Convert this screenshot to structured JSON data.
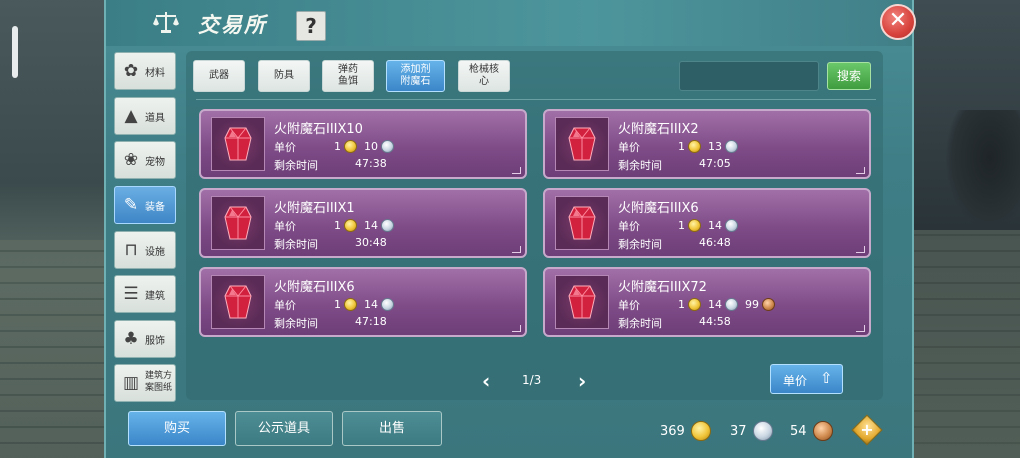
{
  "window": {
    "title": "交易所",
    "help_label": "?",
    "close_label": "✕"
  },
  "sidebar": {
    "items": [
      {
        "label": "材料",
        "icon": "materials-icon",
        "glyph": "✿",
        "active": false
      },
      {
        "label": "道具",
        "icon": "item-icon",
        "glyph": "▲",
        "active": false
      },
      {
        "label": "宠物",
        "icon": "paw-icon",
        "glyph": "❀",
        "active": false
      },
      {
        "label": "装备",
        "icon": "equipment-icon",
        "glyph": "✎",
        "active": true
      },
      {
        "label": "设施",
        "icon": "facility-icon",
        "glyph": "⊓",
        "active": false
      },
      {
        "label": "建筑",
        "icon": "building-icon",
        "glyph": "☰",
        "active": false
      },
      {
        "label": "服饰",
        "icon": "clothing-icon",
        "glyph": "♣",
        "active": false
      },
      {
        "label": "建筑方案图纸",
        "icon": "blueprint-icon",
        "glyph": "▥",
        "active": false
      }
    ]
  },
  "tabs": [
    {
      "label": "武器",
      "active": false
    },
    {
      "label": "防具",
      "active": false
    },
    {
      "label": "弹药\n鱼饵",
      "active": false
    },
    {
      "label": "添加剂\n附魔石",
      "active": true
    },
    {
      "label": "枪械核\n心",
      "active": false
    }
  ],
  "search": {
    "value": "",
    "button_label": "搜索"
  },
  "listings": [
    {
      "name": "火附魔石IIIX10",
      "price_label": "单价",
      "gold": "1",
      "silver": "10",
      "copper": "",
      "time_label": "剩余时间",
      "time": "47:38"
    },
    {
      "name": "火附魔石IIIX2",
      "price_label": "单价",
      "gold": "1",
      "silver": "13",
      "copper": "",
      "time_label": "剩余时间",
      "time": "47:05"
    },
    {
      "name": "火附魔石IIIX1",
      "price_label": "单价",
      "gold": "1",
      "silver": "14",
      "copper": "",
      "time_label": "剩余时间",
      "time": "30:48"
    },
    {
      "name": "火附魔石IIIX6",
      "price_label": "单价",
      "gold": "1",
      "silver": "14",
      "copper": "",
      "time_label": "剩余时间",
      "time": "46:48"
    },
    {
      "name": "火附魔石IIIX6",
      "price_label": "单价",
      "gold": "1",
      "silver": "14",
      "copper": "",
      "time_label": "剩余时间",
      "time": "47:18"
    },
    {
      "name": "火附魔石IIIX72",
      "price_label": "单价",
      "gold": "1",
      "silver": "14",
      "copper": "99",
      "time_label": "剩余时间",
      "time": "44:58"
    }
  ],
  "pagination": {
    "prev": "‹",
    "text": "1/3",
    "next": "›"
  },
  "sort": {
    "label": "单价",
    "arrow": "⇧"
  },
  "bottom_buttons": {
    "buy": "购买",
    "public": "公示道具",
    "sell": "出售"
  },
  "wallet": {
    "gold": "369",
    "silver": "37",
    "copper": "54",
    "add_label": "+"
  },
  "colors": {
    "panel": "#3f7e86",
    "card": "#7f4c88",
    "active_blue": "#3b86c8",
    "search_green": "#3f9c3f",
    "close_red": "#d8423c"
  }
}
